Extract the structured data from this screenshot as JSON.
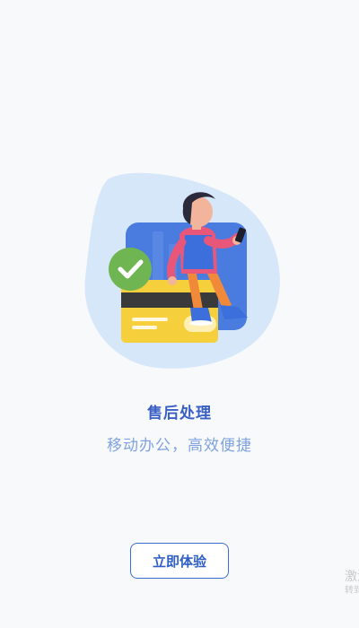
{
  "feature": {
    "title": "售后处理",
    "subtitle": "移动办公，高效便捷"
  },
  "cta": {
    "label": "立即体验"
  },
  "watermark": {
    "line1": "激活",
    "line2": "转到"
  },
  "colors": {
    "background": "#f8f9fb",
    "title": "#3a5fc4",
    "subtitle": "#7fa3e0",
    "button_border": "#3a6fd1",
    "blob": "#d6e7fa",
    "check_badge": "#6fb552",
    "card_yellow": "#f5cf3c"
  },
  "icons": [
    "check-icon",
    "phone-icon"
  ]
}
